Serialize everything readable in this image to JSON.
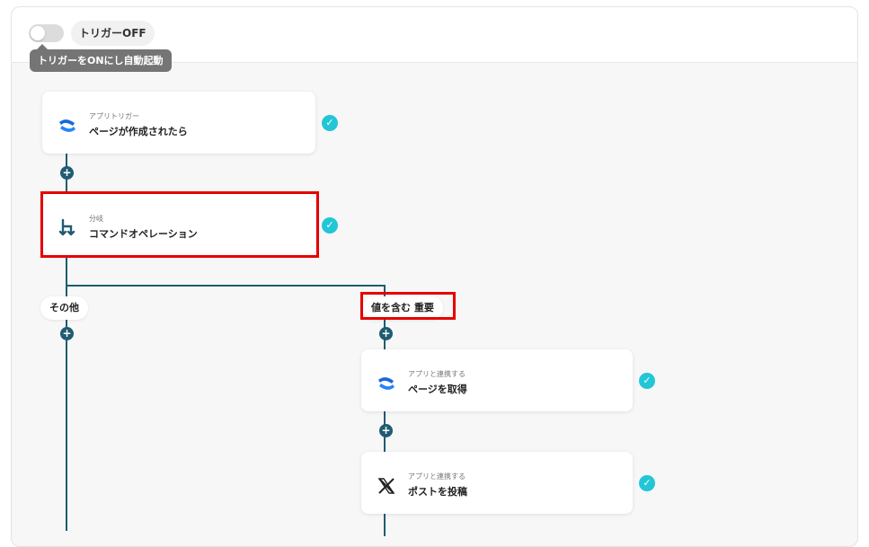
{
  "header": {
    "trigger_toggle_label": "トリガーOFF",
    "tooltip": "トリガーをONにし自動起動"
  },
  "flow": {
    "steps": [
      {
        "sub": "アプリトリガー",
        "title": "ページが作成されたら",
        "icon": "confluence-icon"
      },
      {
        "sub": "分岐",
        "title": "コマンドオペレーション",
        "icon": "branch-icon"
      },
      {
        "sub": "アプリと連携する",
        "title": "ページを取得",
        "icon": "confluence-icon"
      },
      {
        "sub": "アプリと連携する",
        "title": "ポストを投稿",
        "icon": "x-icon"
      }
    ],
    "branch_labels": {
      "other": "その他",
      "contains": "値を含む 重要"
    }
  },
  "colors": {
    "connector": "#1f5c72",
    "check": "#22c6d6",
    "highlight": "#e60000"
  }
}
